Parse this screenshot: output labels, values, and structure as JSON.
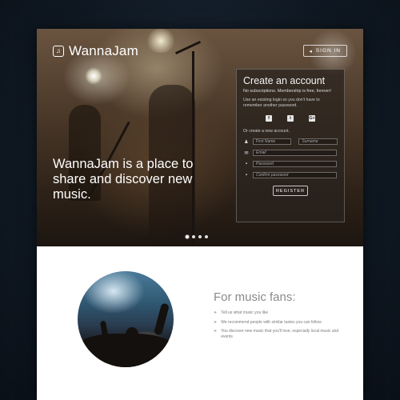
{
  "brand": {
    "name": "WannaJam",
    "logo_icon": "music-note-badge"
  },
  "header": {
    "signin_label": "SIGN IN",
    "signin_icon": "enter-icon"
  },
  "hero": {
    "tagline": "WannaJam is a place to share and discover new music."
  },
  "register": {
    "title": "Create an account",
    "subtitle": "No subscriptions. Membership is free, forever!",
    "social_note": "Use an existing login so you don't have to remember another password.",
    "socials": [
      {
        "name": "facebook-icon",
        "glyph": "f"
      },
      {
        "name": "twitter-icon",
        "glyph": "t"
      },
      {
        "name": "google-plus-icon",
        "glyph": "G+"
      }
    ],
    "or_new": "Or create a new account.",
    "fields": {
      "first_name": {
        "placeholder": "First Name"
      },
      "surname": {
        "placeholder": "Surname"
      },
      "email": {
        "placeholder": "Email"
      },
      "password": {
        "placeholder": "Password"
      },
      "confirm_password": {
        "placeholder": "Confirm password"
      }
    },
    "button_label": "REGISTER"
  },
  "carousel": {
    "count": 4,
    "active_index": 0
  },
  "fans": {
    "title": "For music fans:",
    "items": [
      "Tell us what music you like",
      "We recommend people with similar tastes you can follow",
      "You discover new music that you'll love, especially local music and events"
    ]
  },
  "colors": {
    "background": "#0f1822",
    "panel": "#28221e",
    "text_muted": "#8a8a8a"
  }
}
